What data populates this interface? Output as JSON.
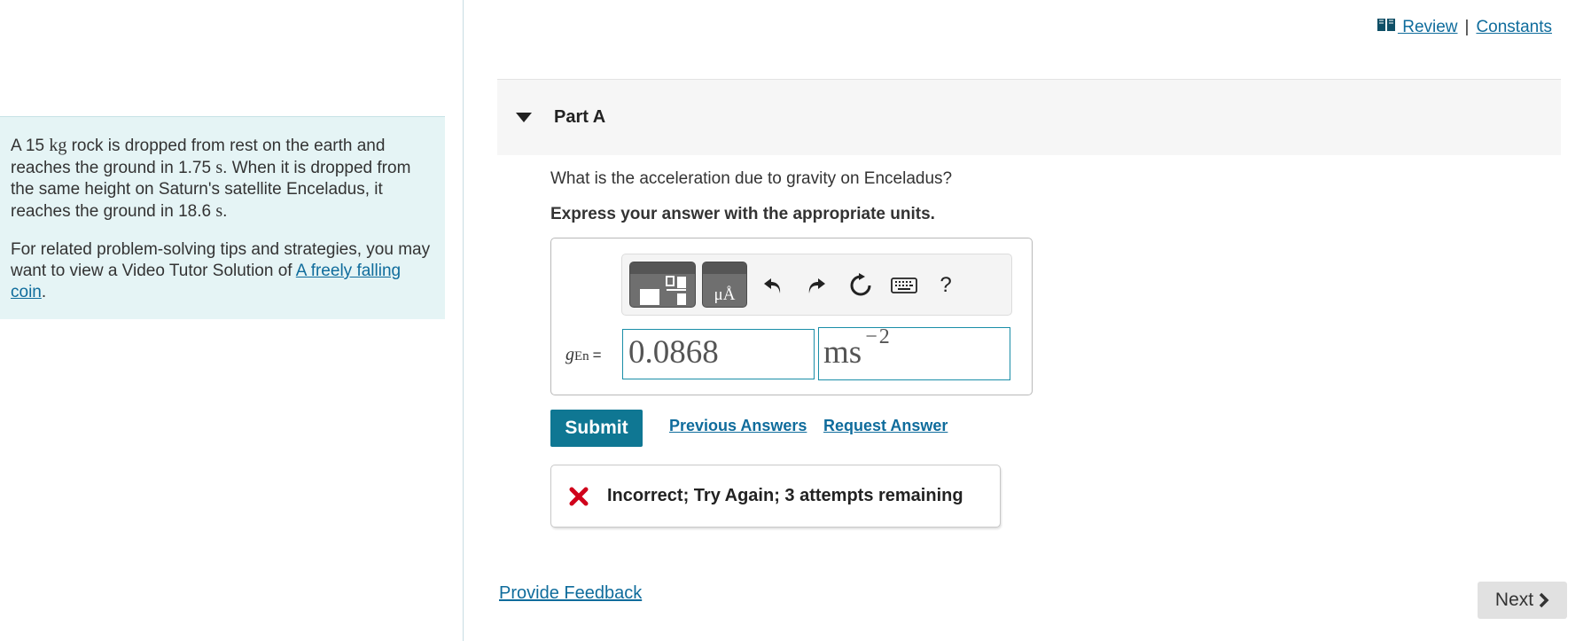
{
  "intro": {
    "p1_a": "A 15 ",
    "p1_unit": "kg",
    "p1_b": " rock is dropped from rest on the earth and reaches the ground in 1.75 ",
    "p1_s1": "s",
    "p1_c": ". When it is dropped from the same height on Saturn's satellite Enceladus, it reaches the ground in 18.6 ",
    "p1_s2": "s",
    "p1_d": ".",
    "p2_text": "For related problem-solving tips and strategies, you may want to view a Video Tutor Solution of ",
    "p2_link": "A freely falling coin",
    "p2_end": "."
  },
  "top_links": {
    "review": " Review",
    "separator": "|",
    "constants": "Constants"
  },
  "part": {
    "title": "Part A",
    "question": "What is the acceleration due to gravity on Enceladus?",
    "instructions": "Express your answer with the appropriate units."
  },
  "toolbar": {
    "units_glyph": "μÅ",
    "help_label": "?"
  },
  "answer": {
    "var_symbol": "g",
    "var_subscript": "En",
    "equals": "=",
    "value": "0.0868",
    "units_base": "ms",
    "units_exponent": "−2"
  },
  "actions": {
    "submit": "Submit",
    "previous_answers": "Previous Answers",
    "request_answer": "Request Answer"
  },
  "feedback": {
    "message": "Incorrect; Try Again; 3 attempts remaining"
  },
  "footer": {
    "provide_feedback": "Provide Feedback",
    "next": "Next"
  },
  "colors": {
    "accent": "#0f7793",
    "link": "#0f6c9c",
    "intro_bg": "#e5f4f5",
    "error": "#d0021b"
  }
}
